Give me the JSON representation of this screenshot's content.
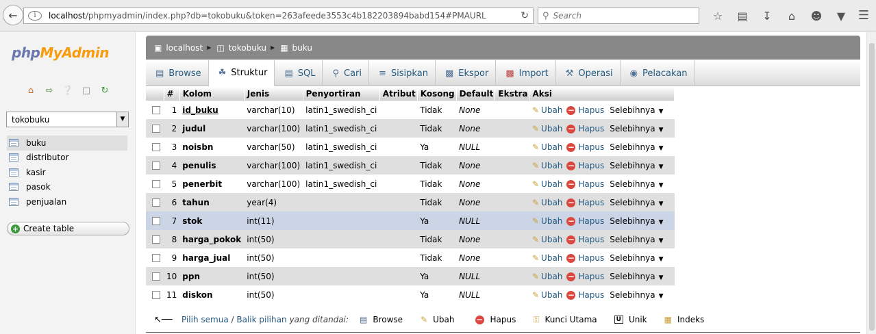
{
  "browser": {
    "url_host": "localhost",
    "url_path": "/phpmyadmin/index.php?db=tokobuku&token=263afeede3553c4b182203894babd154#PMAURL:db=tokobuku&ta",
    "search_placeholder": "Search"
  },
  "sidebar": {
    "logo_php": "php",
    "logo_my": "My",
    "logo_admin": "Admin",
    "db_selected": "tokobuku",
    "tables": [
      {
        "label": "buku"
      },
      {
        "label": "distributor"
      },
      {
        "label": "kasir"
      },
      {
        "label": "pasok"
      },
      {
        "label": "penjualan"
      }
    ],
    "create_table": "Create table"
  },
  "breadcrumb": {
    "server": "localhost",
    "database": "tokobuku",
    "table": "buku"
  },
  "tabs": [
    {
      "label": "Browse"
    },
    {
      "label": "Struktur"
    },
    {
      "label": "SQL"
    },
    {
      "label": "Cari"
    },
    {
      "label": "Sisipkan"
    },
    {
      "label": "Ekspor"
    },
    {
      "label": "Import"
    },
    {
      "label": "Operasi"
    },
    {
      "label": "Pelacakan"
    }
  ],
  "table": {
    "headers": {
      "num": "#",
      "kolom": "Kolom",
      "jenis": "Jenis",
      "penyortiran": "Penyortiran",
      "atribut": "Atribut",
      "kosong": "Kosong",
      "default": "Default",
      "ekstra": "Ekstra",
      "aksi": "Aksi"
    },
    "actions": {
      "ubah": "Ubah",
      "hapus": "Hapus",
      "selebihnya": "Selebihnya"
    },
    "rows": [
      {
        "num": "1",
        "name": "id_buku",
        "type": "varchar(10)",
        "collation": "latin1_swedish_ci",
        "attr": "",
        "null": "Tidak",
        "default": "None",
        "extra": ""
      },
      {
        "num": "2",
        "name": "judul",
        "type": "varchar(100)",
        "collation": "latin1_swedish_ci",
        "attr": "",
        "null": "Tidak",
        "default": "None",
        "extra": ""
      },
      {
        "num": "3",
        "name": "noisbn",
        "type": "varchar(50)",
        "collation": "latin1_swedish_ci",
        "attr": "",
        "null": "Ya",
        "default": "NULL",
        "extra": ""
      },
      {
        "num": "4",
        "name": "penulis",
        "type": "varchar(100)",
        "collation": "latin1_swedish_ci",
        "attr": "",
        "null": "Tidak",
        "default": "None",
        "extra": ""
      },
      {
        "num": "5",
        "name": "penerbit",
        "type": "varchar(100)",
        "collation": "latin1_swedish_ci",
        "attr": "",
        "null": "Tidak",
        "default": "None",
        "extra": ""
      },
      {
        "num": "6",
        "name": "tahun",
        "type": "year(4)",
        "collation": "",
        "attr": "",
        "null": "Tidak",
        "default": "None",
        "extra": ""
      },
      {
        "num": "7",
        "name": "stok",
        "type": "int(11)",
        "collation": "",
        "attr": "",
        "null": "Ya",
        "default": "NULL",
        "extra": ""
      },
      {
        "num": "8",
        "name": "harga_pokok",
        "type": "int(50)",
        "collation": "",
        "attr": "",
        "null": "Tidak",
        "default": "None",
        "extra": ""
      },
      {
        "num": "9",
        "name": "harga_jual",
        "type": "int(50)",
        "collation": "",
        "attr": "",
        "null": "Tidak",
        "default": "None",
        "extra": ""
      },
      {
        "num": "10",
        "name": "ppn",
        "type": "int(50)",
        "collation": "",
        "attr": "",
        "null": "Ya",
        "default": "NULL",
        "extra": ""
      },
      {
        "num": "11",
        "name": "diskon",
        "type": "int(50)",
        "collation": "",
        "attr": "",
        "null": "Ya",
        "default": "NULL",
        "extra": ""
      }
    ]
  },
  "bulk": {
    "check_all": "Pilih semua",
    "separator": " / ",
    "invert": "Balik pilihan",
    "with_selected": "yang ditandai:",
    "buttons": [
      {
        "label": "Browse"
      },
      {
        "label": "Ubah"
      },
      {
        "label": "Hapus"
      },
      {
        "label": "Kunci Utama"
      },
      {
        "label": "Unik"
      },
      {
        "label": "Indeks"
      }
    ]
  }
}
